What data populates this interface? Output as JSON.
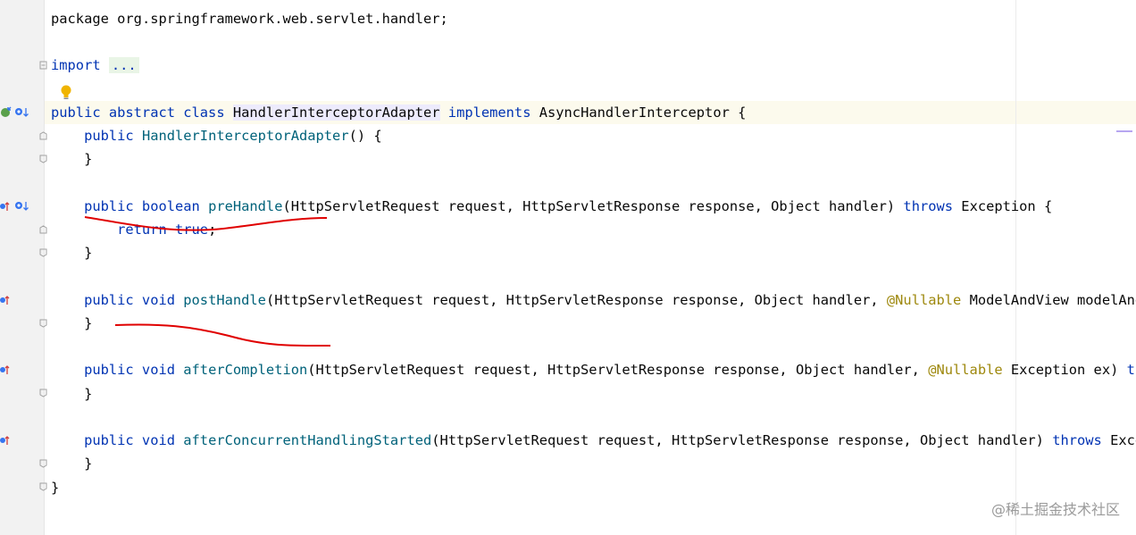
{
  "code_lines": [
    {
      "tokens": [
        {
          "t": "package",
          "c": "plain"
        },
        {
          "t": " org.springframework.web.servlet.handler;",
          "c": "plain"
        }
      ]
    },
    {
      "tokens": []
    },
    {
      "tokens": [
        {
          "t": "import",
          "c": "kw"
        },
        {
          "t": " ",
          "c": "plain"
        },
        {
          "t": "...",
          "c": "fold"
        }
      ]
    },
    {
      "tokens": []
    },
    {
      "tokens": [
        {
          "t": "public abstract class ",
          "c": "kw"
        },
        {
          "t": "HandlerInterceptorAdapter",
          "c": "hl"
        },
        {
          "t": " ",
          "c": "plain"
        },
        {
          "t": "implements",
          "c": "kw"
        },
        {
          "t": " AsyncHandlerInterceptor {",
          "c": "plain"
        }
      ]
    },
    {
      "tokens": [
        {
          "t": "    public ",
          "c": "kw"
        },
        {
          "t": "HandlerInterceptorAdapter",
          "c": "m"
        },
        {
          "t": "() {",
          "c": "plain"
        }
      ]
    },
    {
      "tokens": [
        {
          "t": "    }",
          "c": "plain"
        }
      ]
    },
    {
      "tokens": []
    },
    {
      "tokens": [
        {
          "t": "    public boolean ",
          "c": "kw"
        },
        {
          "t": "preHandle",
          "c": "m"
        },
        {
          "t": "(HttpServletRequest request, HttpServletResponse response, Object handler) ",
          "c": "plain"
        },
        {
          "t": "throws",
          "c": "kw"
        },
        {
          "t": " Exception {",
          "c": "plain"
        }
      ]
    },
    {
      "tokens": [
        {
          "t": "        return true",
          "c": "kw"
        },
        {
          "t": ";",
          "c": "plain"
        }
      ]
    },
    {
      "tokens": [
        {
          "t": "    }",
          "c": "plain"
        }
      ]
    },
    {
      "tokens": []
    },
    {
      "tokens": [
        {
          "t": "    public void ",
          "c": "kw"
        },
        {
          "t": "postHandle",
          "c": "m"
        },
        {
          "t": "(HttpServletRequest request, HttpServletResponse response, Object handler, ",
          "c": "plain"
        },
        {
          "t": "@Nullable",
          "c": "ann"
        },
        {
          "t": " ModelAndView modelAndVie",
          "c": "plain"
        }
      ]
    },
    {
      "tokens": [
        {
          "t": "    }",
          "c": "plain"
        }
      ]
    },
    {
      "tokens": []
    },
    {
      "tokens": [
        {
          "t": "    public void ",
          "c": "kw"
        },
        {
          "t": "afterCompletion",
          "c": "m"
        },
        {
          "t": "(HttpServletRequest request, HttpServletResponse response, Object handler, ",
          "c": "plain"
        },
        {
          "t": "@Nullable",
          "c": "ann"
        },
        {
          "t": " Exception ex) ",
          "c": "plain"
        },
        {
          "t": "throw",
          "c": "kw"
        }
      ]
    },
    {
      "tokens": [
        {
          "t": "    }",
          "c": "plain"
        }
      ]
    },
    {
      "tokens": []
    },
    {
      "tokens": [
        {
          "t": "    public void ",
          "c": "kw"
        },
        {
          "t": "afterConcurrentHandlingStarted",
          "c": "m"
        },
        {
          "t": "(HttpServletRequest request, HttpServletResponse response, Object handler) ",
          "c": "plain"
        },
        {
          "t": "throws",
          "c": "kw"
        },
        {
          "t": " Excepti",
          "c": "plain"
        }
      ]
    },
    {
      "tokens": [
        {
          "t": "    }",
          "c": "plain"
        }
      ]
    },
    {
      "tokens": [
        {
          "t": "}",
          "c": "plain"
        }
      ]
    }
  ],
  "watermark": "@稀土掘金技术社区",
  "icons": {
    "bulb": "lightbulb-icon",
    "implementing": "implemented-by-icon",
    "overriding": "overrides-method-icon"
  },
  "colors": {
    "keyword": "#0033b3",
    "method": "#00627a",
    "annotation": "#9e880d",
    "red_strokes": "#e00000"
  }
}
